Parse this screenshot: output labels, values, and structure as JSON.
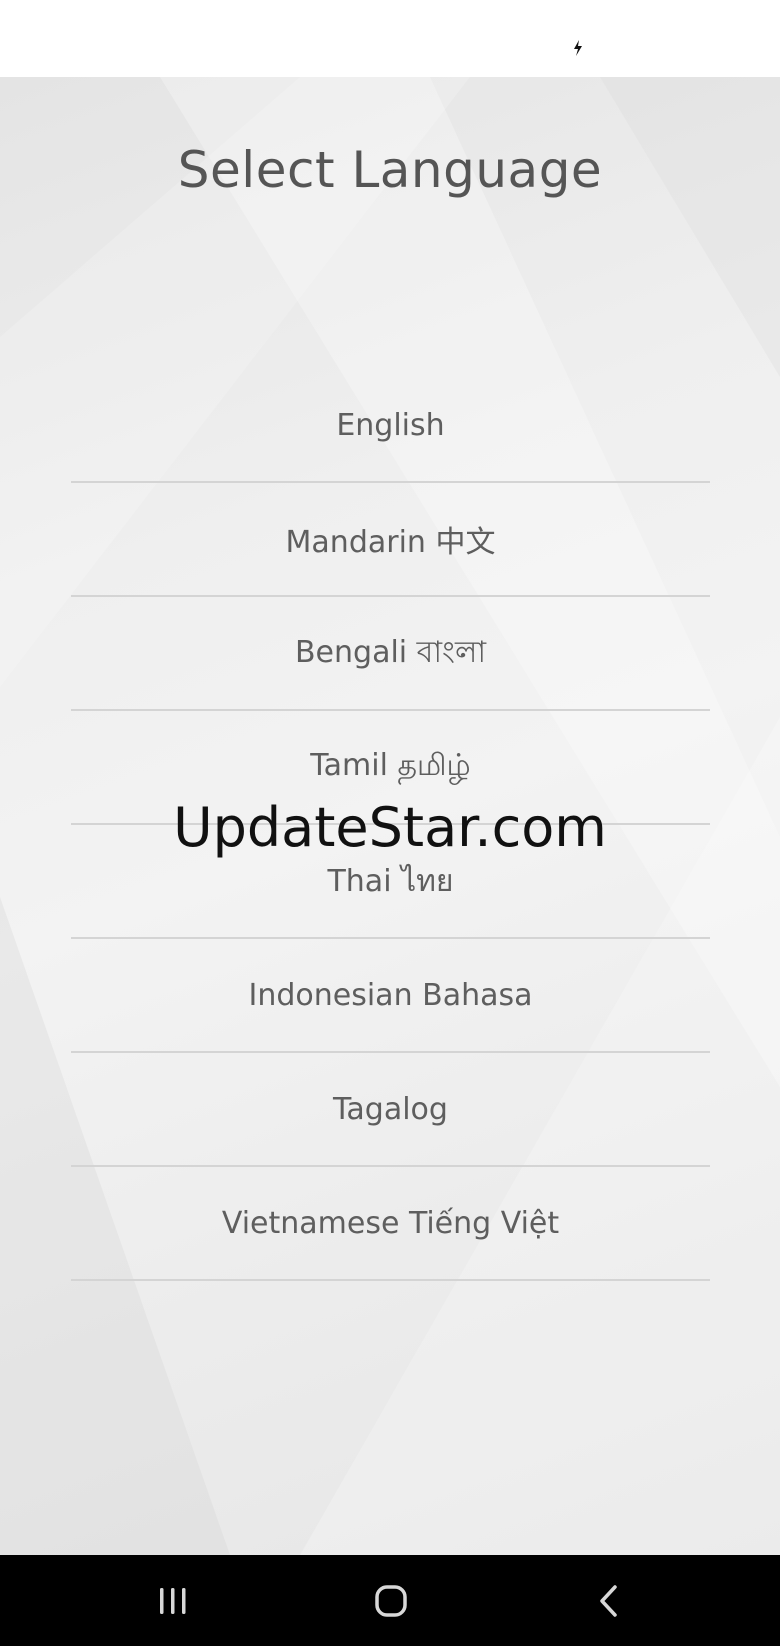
{
  "screen": {
    "title": "Select Language"
  },
  "languages": [
    {
      "label": "English"
    },
    {
      "label": "Mandarin 中文"
    },
    {
      "label": "Bengali বাংলা"
    },
    {
      "label": "Tamil தமிழ்"
    },
    {
      "label": "Thai ไทย"
    },
    {
      "label": "Indonesian Bahasa"
    },
    {
      "label": "Tagalog"
    },
    {
      "label": "Vietnamese Tiếng Việt"
    }
  ],
  "watermark": {
    "text": "UpdateStar.com"
  },
  "status_bar": {
    "icons": [
      "charging-icon"
    ]
  },
  "nav_bar": {
    "buttons": [
      "recent-apps-icon",
      "home-icon",
      "back-icon"
    ]
  },
  "colors": {
    "title_text": "#555555",
    "item_text": "#5e5e5e",
    "divider": "#d4d4d4",
    "nav_bar": "#000000"
  }
}
